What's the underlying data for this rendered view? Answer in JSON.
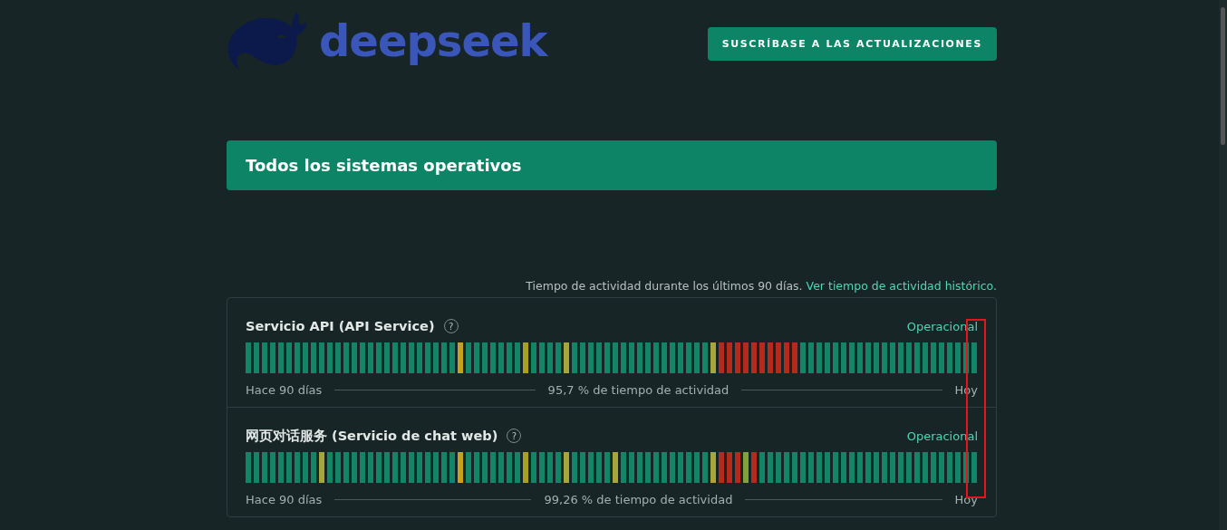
{
  "header": {
    "logo_text": "deepseek",
    "subscribe_button": "SUSCRÍBASE A LAS ACTUALIZACIONES"
  },
  "status_banner": {
    "title": "Todos los sistemas operativos"
  },
  "uptime_note": {
    "text": "Tiempo de actividad durante los últimos 90 días.",
    "link": "Ver tiempo de actividad histórico."
  },
  "components": [
    {
      "name": "Servicio API (API Service)",
      "help": "?",
      "status": "Operacional",
      "start_label": "Hace 90 días",
      "uptime": "95,7 % de tiempo de actividad",
      "end_label": "Hoy",
      "days": [
        {
          "color": "#118565"
        },
        {
          "color": "#118565"
        },
        {
          "color": "#118565"
        },
        {
          "color": "#118565"
        },
        {
          "color": "#118565"
        },
        {
          "color": "#118565"
        },
        {
          "color": "#118565"
        },
        {
          "color": "#118565"
        },
        {
          "color": "#118565"
        },
        {
          "color": "#118565"
        },
        {
          "color": "#118565"
        },
        {
          "color": "#118565"
        },
        {
          "color": "#118565"
        },
        {
          "color": "#118565"
        },
        {
          "color": "#118565"
        },
        {
          "color": "#118565"
        },
        {
          "color": "#118565"
        },
        {
          "color": "#118565"
        },
        {
          "color": "#118565"
        },
        {
          "color": "#118565"
        },
        {
          "color": "#118565"
        },
        {
          "color": "#118565"
        },
        {
          "color": "#118565"
        },
        {
          "color": "#118565"
        },
        {
          "color": "#118565"
        },
        {
          "color": "#118565"
        },
        {
          "color": "#c4a21e"
        },
        {
          "color": "#118565"
        },
        {
          "color": "#118565"
        },
        {
          "color": "#118565"
        },
        {
          "color": "#118565"
        },
        {
          "color": "#118565"
        },
        {
          "color": "#118565"
        },
        {
          "color": "#118565"
        },
        {
          "color": "#a8a023"
        },
        {
          "color": "#118565"
        },
        {
          "color": "#118565"
        },
        {
          "color": "#118565"
        },
        {
          "color": "#118565"
        },
        {
          "color": "#a6a63a"
        },
        {
          "color": "#118565"
        },
        {
          "color": "#118565"
        },
        {
          "color": "#118565"
        },
        {
          "color": "#118565"
        },
        {
          "color": "#118565"
        },
        {
          "color": "#118565"
        },
        {
          "color": "#118565"
        },
        {
          "color": "#118565"
        },
        {
          "color": "#118565"
        },
        {
          "color": "#118565"
        },
        {
          "color": "#118565"
        },
        {
          "color": "#118565"
        },
        {
          "color": "#118565"
        },
        {
          "color": "#118565"
        },
        {
          "color": "#118565"
        },
        {
          "color": "#118565"
        },
        {
          "color": "#118565"
        },
        {
          "color": "#a6a63a"
        },
        {
          "color": "#b42b1d"
        },
        {
          "color": "#b42b1d"
        },
        {
          "color": "#b42b1d"
        },
        {
          "color": "#b42b1d"
        },
        {
          "color": "#b42b1d"
        },
        {
          "color": "#b42b1d"
        },
        {
          "color": "#b42b1d"
        },
        {
          "color": "#b42b1d"
        },
        {
          "color": "#b42b1d"
        },
        {
          "color": "#b42b1d"
        },
        {
          "color": "#118565"
        },
        {
          "color": "#118565"
        },
        {
          "color": "#118565"
        },
        {
          "color": "#118565"
        },
        {
          "color": "#118565"
        },
        {
          "color": "#118565"
        },
        {
          "color": "#118565"
        },
        {
          "color": "#118565"
        },
        {
          "color": "#118565"
        },
        {
          "color": "#118565"
        },
        {
          "color": "#118565"
        },
        {
          "color": "#118565"
        },
        {
          "color": "#118565"
        },
        {
          "color": "#118565"
        },
        {
          "color": "#118565"
        },
        {
          "color": "#118565"
        },
        {
          "color": "#118565"
        },
        {
          "color": "#118565"
        },
        {
          "color": "#118565"
        },
        {
          "color": "#118565"
        },
        {
          "color": "#118565"
        },
        {
          "color": "#118565"
        }
      ]
    },
    {
      "name": "网页对话服务 (Servicio de chat web)",
      "help": "?",
      "status": "Operacional",
      "start_label": "Hace 90 días",
      "uptime": "99,26 % de tiempo de actividad",
      "end_label": "Hoy",
      "days": [
        {
          "color": "#118565"
        },
        {
          "color": "#118565"
        },
        {
          "color": "#118565"
        },
        {
          "color": "#118565"
        },
        {
          "color": "#118565"
        },
        {
          "color": "#118565"
        },
        {
          "color": "#118565"
        },
        {
          "color": "#118565"
        },
        {
          "color": "#118565"
        },
        {
          "color": "#a6a63a"
        },
        {
          "color": "#118565"
        },
        {
          "color": "#118565"
        },
        {
          "color": "#118565"
        },
        {
          "color": "#118565"
        },
        {
          "color": "#118565"
        },
        {
          "color": "#118565"
        },
        {
          "color": "#118565"
        },
        {
          "color": "#118565"
        },
        {
          "color": "#118565"
        },
        {
          "color": "#118565"
        },
        {
          "color": "#118565"
        },
        {
          "color": "#118565"
        },
        {
          "color": "#118565"
        },
        {
          "color": "#118565"
        },
        {
          "color": "#118565"
        },
        {
          "color": "#118565"
        },
        {
          "color": "#c4a21e"
        },
        {
          "color": "#118565"
        },
        {
          "color": "#118565"
        },
        {
          "color": "#118565"
        },
        {
          "color": "#118565"
        },
        {
          "color": "#118565"
        },
        {
          "color": "#118565"
        },
        {
          "color": "#118565"
        },
        {
          "color": "#a8a023"
        },
        {
          "color": "#118565"
        },
        {
          "color": "#118565"
        },
        {
          "color": "#118565"
        },
        {
          "color": "#118565"
        },
        {
          "color": "#a6a63a"
        },
        {
          "color": "#118565"
        },
        {
          "color": "#118565"
        },
        {
          "color": "#118565"
        },
        {
          "color": "#118565"
        },
        {
          "color": "#118565"
        },
        {
          "color": "#a6a63a"
        },
        {
          "color": "#118565"
        },
        {
          "color": "#118565"
        },
        {
          "color": "#118565"
        },
        {
          "color": "#118565"
        },
        {
          "color": "#118565"
        },
        {
          "color": "#118565"
        },
        {
          "color": "#118565"
        },
        {
          "color": "#118565"
        },
        {
          "color": "#118565"
        },
        {
          "color": "#118565"
        },
        {
          "color": "#118565"
        },
        {
          "color": "#a6a63a"
        },
        {
          "color": "#b42b1d"
        },
        {
          "color": "#b42b1d"
        },
        {
          "color": "#b42b1d"
        },
        {
          "color": "#7ea33c"
        },
        {
          "color": "#b42b1d"
        },
        {
          "color": "#118565"
        },
        {
          "color": "#118565"
        },
        {
          "color": "#118565"
        },
        {
          "color": "#118565"
        },
        {
          "color": "#118565"
        },
        {
          "color": "#118565"
        },
        {
          "color": "#118565"
        },
        {
          "color": "#118565"
        },
        {
          "color": "#118565"
        },
        {
          "color": "#118565"
        },
        {
          "color": "#118565"
        },
        {
          "color": "#118565"
        },
        {
          "color": "#118565"
        },
        {
          "color": "#118565"
        },
        {
          "color": "#118565"
        },
        {
          "color": "#118565"
        },
        {
          "color": "#118565"
        },
        {
          "color": "#118565"
        },
        {
          "color": "#118565"
        },
        {
          "color": "#118565"
        },
        {
          "color": "#118565"
        },
        {
          "color": "#118565"
        },
        {
          "color": "#118565"
        },
        {
          "color": "#118565"
        },
        {
          "color": "#118565"
        },
        {
          "color": "#118565"
        },
        {
          "color": "#118565"
        }
      ]
    }
  ],
  "annotation": {
    "kind": "highlight-box"
  }
}
